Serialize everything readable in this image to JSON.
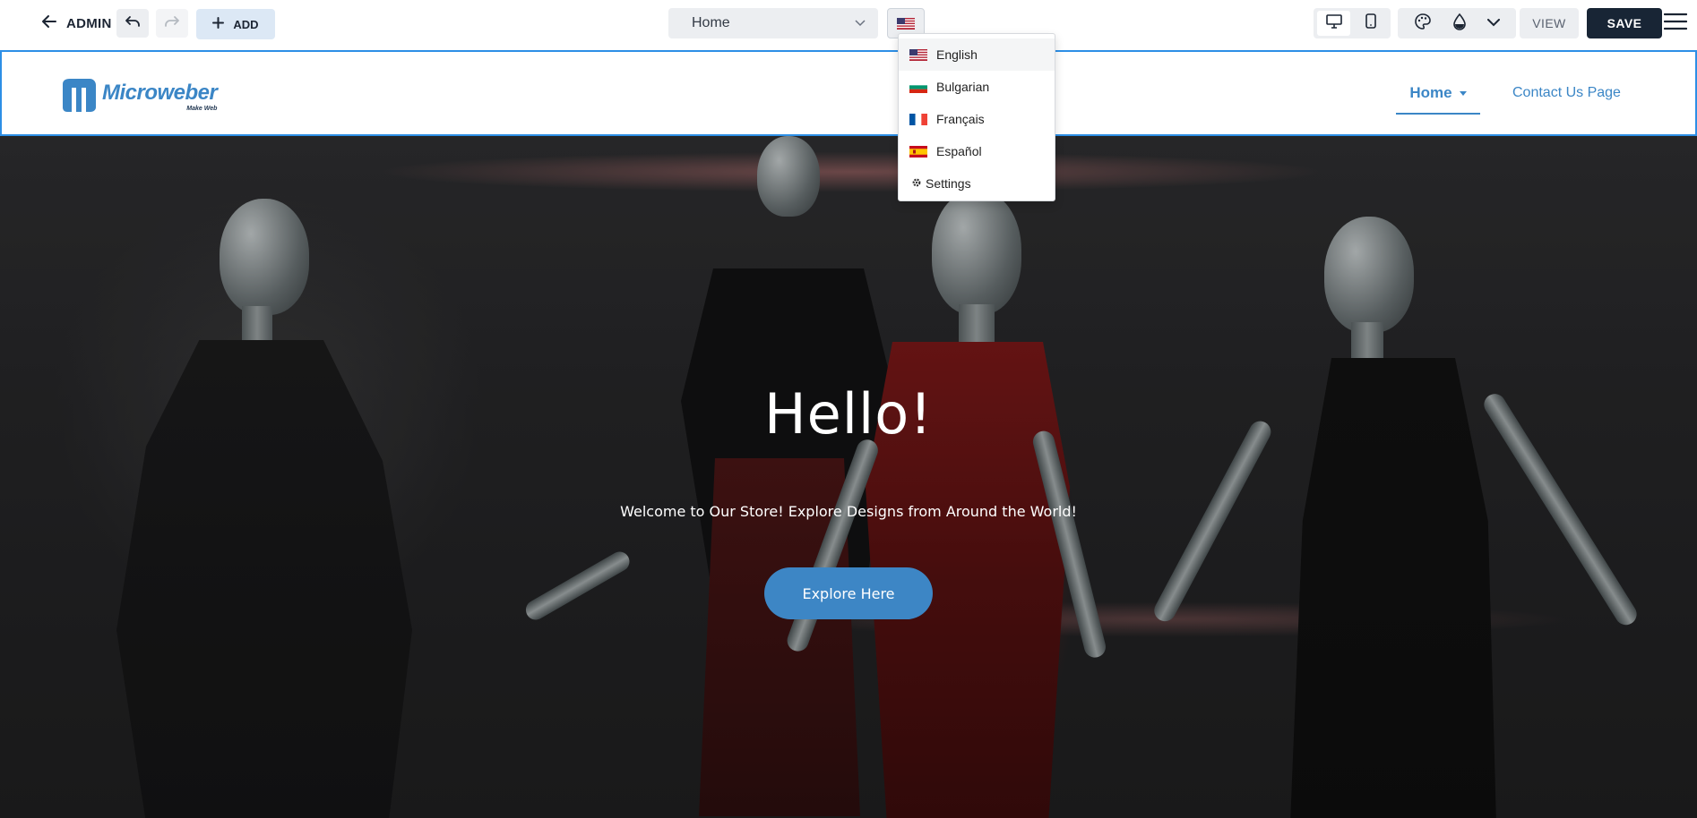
{
  "toolbar": {
    "admin_label": "ADMIN",
    "add_label": "ADD",
    "page_select_value": "Home",
    "current_language_flag": "us-flag",
    "view_label": "VIEW",
    "save_label": "SAVE"
  },
  "language_menu": {
    "items": [
      {
        "label": "English",
        "flag": "us-flag",
        "active": true
      },
      {
        "label": "Bulgarian",
        "flag": "bg-flag",
        "active": false
      },
      {
        "label": "Français",
        "flag": "fr-flag",
        "active": false
      },
      {
        "label": "Español",
        "flag": "es-flag",
        "active": false
      }
    ],
    "settings_label": "Settings"
  },
  "site": {
    "logo_name": "Microweber",
    "logo_tagline": "Make Web",
    "nav": {
      "home": "Home",
      "contact": "Contact Us Page"
    },
    "hero": {
      "title": "Hello!",
      "subtitle": "Welcome to Our Store! Explore Designs from Around the World!",
      "button": "Explore Here"
    }
  },
  "colors": {
    "brand_blue": "#3b86c6",
    "selection_outline": "#2d8fe6",
    "save_button": "#182535"
  }
}
